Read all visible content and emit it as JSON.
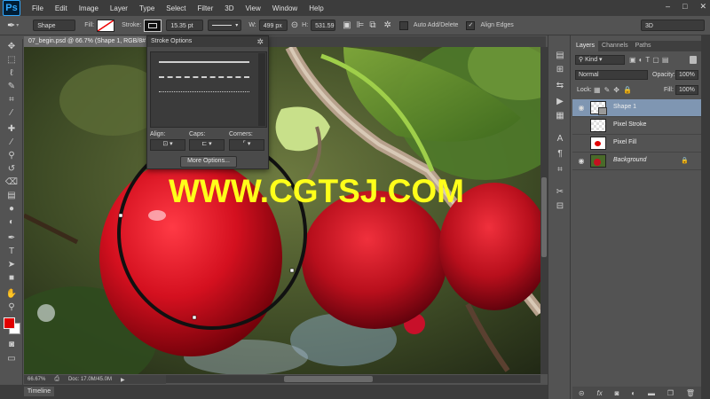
{
  "app": {
    "logo": "Ps"
  },
  "menu": [
    "File",
    "Edit",
    "Image",
    "Layer",
    "Type",
    "Select",
    "Filter",
    "3D",
    "View",
    "Window",
    "Help"
  ],
  "window_controls": [
    "–",
    "□",
    "✕"
  ],
  "options_bar": {
    "tool_mode": "Shape",
    "fill_label": "Fill:",
    "stroke_label": "Stroke:",
    "stroke_width": "15.35 pt",
    "w_label": "W:",
    "w_value": "499 px",
    "h_label": "H:",
    "h_value": "531.59",
    "auto_add_delete": "Auto Add/Delete",
    "align_edges": "Align Edges",
    "workspace": "3D"
  },
  "document": {
    "tab_title": "07_begin.psd @ 66.7% (Shape 1, RGB/8#",
    "zoom": "66.67%",
    "doc_size": "Doc: 17.0M/45.0M",
    "watermark": "WWW.CGTSJ.COM"
  },
  "stroke_options": {
    "title": "Stroke Options",
    "align_label": "Align:",
    "caps_label": "Caps:",
    "corners_label": "Corners:",
    "more_button": "More Options..."
  },
  "timeline_tab": "Timeline",
  "layers_panel": {
    "tabs": [
      "Layers",
      "Channels",
      "Paths"
    ],
    "filter_kind": "Kind",
    "blend_mode": "Normal",
    "opacity_label": "Opacity:",
    "opacity_value": "100%",
    "lock_label": "Lock:",
    "fill_label": "Fill:",
    "fill_value": "100%",
    "layers": [
      {
        "name": "Shape 1",
        "visible": true,
        "selected": true
      },
      {
        "name": "Pixel Stroke",
        "visible": false,
        "selected": false
      },
      {
        "name": "Pixel Fill",
        "visible": false,
        "selected": false
      },
      {
        "name": "Background",
        "visible": true,
        "selected": false,
        "locked": true
      }
    ],
    "bottom_icons": [
      "link-icon",
      "fx-icon",
      "mask-icon",
      "adjustment-icon",
      "folder-icon",
      "new-layer-icon",
      "trash-icon"
    ]
  },
  "colors": {
    "foreground": "#e10000",
    "background": "#ffffff",
    "watermark": "#ffff1a",
    "selected_layer": "#7f96b2"
  }
}
